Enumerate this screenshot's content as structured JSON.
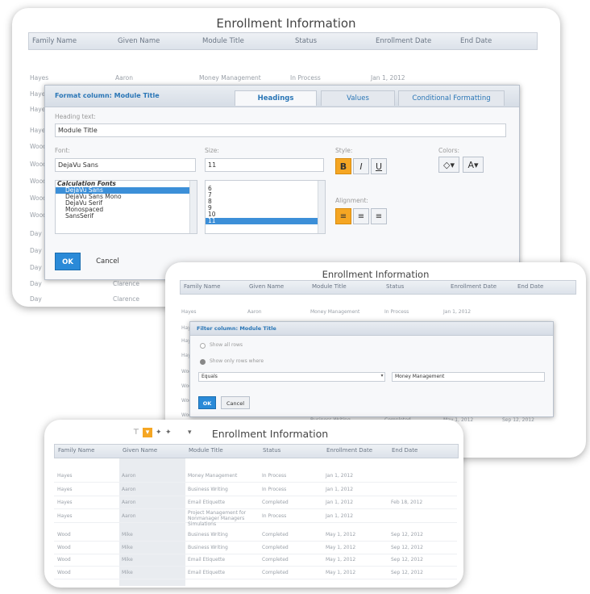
{
  "main": {
    "title": "Enrollment Information",
    "headers": [
      "Family Name",
      "Given Name",
      "Module Title",
      "Status",
      "Enrollment Date",
      "End Date"
    ],
    "first_row": [
      "Hayes",
      "Aaron",
      "Money Management",
      "In Process",
      "Jan 1, 2012"
    ],
    "left_names": [
      "Hayes",
      "Hayes",
      "Hayes",
      "Hayes",
      "Wood",
      "Wood",
      "Wood",
      "Wood",
      "Wood",
      "Day",
      "Day",
      "Day",
      "Day",
      "Day"
    ],
    "bottom_given": [
      "Clarence",
      "Clarence"
    ]
  },
  "format_dialog": {
    "title": "Format column: Module Title",
    "tabs": [
      "Headings",
      "Values",
      "Conditional Formatting"
    ],
    "heading_label": "Heading text:",
    "heading_value": "Module Title",
    "font_label": "Font:",
    "font_value": "DejaVu Sans",
    "size_label": "Size:",
    "size_value": "11",
    "style_label": "Style:",
    "color_label": "Colors:",
    "align_label": "Alignment:",
    "font_list_header": "Calculation Fonts",
    "font_list": [
      "DejaVu Sans",
      "DejaVu Sans Mono",
      "DejaVu Serif",
      "Monospaced",
      "SansSerif"
    ],
    "size_list": [
      "6",
      "7",
      "8",
      "9",
      "10",
      "11"
    ],
    "selected_size": "11",
    "style_buttons": [
      "B",
      "I",
      "U"
    ],
    "ok": "OK",
    "cancel": "Cancel"
  },
  "filter_panel": {
    "title": "Enrollment Information",
    "headers": [
      "Family Name",
      "Given Name",
      "Module Title",
      "Status",
      "Enrollment Date",
      "End Date"
    ],
    "row": [
      "Hayes",
      "Aaron",
      "Money Management",
      "In Process",
      "Jan 1, 2012"
    ],
    "left_names": [
      "Hayes",
      "Hayes",
      "Hayes",
      "Wood",
      "Wood",
      "Wood",
      "Wood"
    ],
    "dialog_title": "Filter column: Module Title",
    "opt_all": "Show all rows",
    "opt_where": "Show only rows where",
    "operator": "Equals",
    "value": "Money Management",
    "ok": "OK",
    "cancel": "Cancel",
    "peek_row": [
      "Business Writing",
      "Completed",
      "May 1, 2012",
      "Sep 12, 2012"
    ]
  },
  "table_panel": {
    "title": "Enrollment Information",
    "headers": [
      "Family Name",
      "Given Name",
      "Module Title",
      "Status",
      "Enrollment Date",
      "End Date"
    ],
    "rows": [
      [
        "Hayes",
        "Aaron",
        "Money Management",
        "In Process",
        "Jan 1, 2012",
        ""
      ],
      [
        "Hayes",
        "Aaron",
        "Business Writing",
        "In Process",
        "Jan 1, 2012",
        ""
      ],
      [
        "Hayes",
        "Aaron",
        "Email Etiquette",
        "Completed",
        "Jan 1, 2012",
        "Feb 18, 2012"
      ],
      [
        "Hayes",
        "Aaron",
        "Project Management for Nonmanager Managers Simulations",
        "In Process",
        "Jan 1, 2012",
        ""
      ],
      [
        "Wood",
        "Mike",
        "Business Writing",
        "Completed",
        "May 1, 2012",
        "Sep 12, 2012"
      ],
      [
        "Wood",
        "Mike",
        "Business Writing",
        "Completed",
        "May 1, 2012",
        "Sep 12, 2012"
      ],
      [
        "Wood",
        "Mike",
        "Email Etiquette",
        "Completed",
        "May 1, 2012",
        "Sep 12, 2012"
      ],
      [
        "Wood",
        "Mike",
        "Email Etiquette",
        "Completed",
        "May 1, 2012",
        "Sep 12, 2012"
      ]
    ],
    "toolbar_icons": [
      "filter-icon",
      "sort-icon",
      "add-icon",
      "add-icon",
      "dropdown-icon"
    ]
  }
}
